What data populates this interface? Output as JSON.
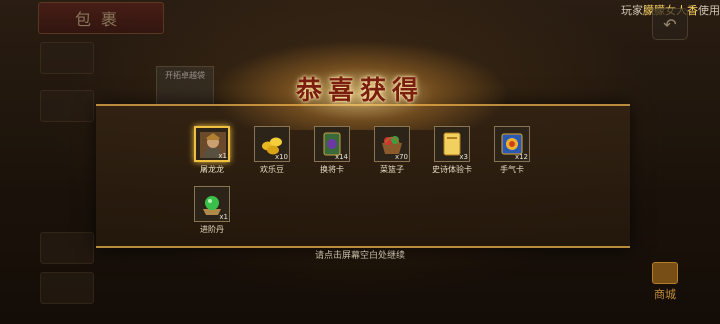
{
  "background": {
    "bag_tab": "包裹",
    "bag_card_label": "开拓卓越袋",
    "shop_label": "商城",
    "top_bar": {
      "prefix": "玩家",
      "player": "朦朦女人香",
      "suffix": "使用"
    }
  },
  "modal": {
    "title": "恭喜获得",
    "hint": "请点击屏幕空白处继续",
    "items": [
      {
        "name": "屠龙龙",
        "qty": "x1",
        "icon": "hero-portrait-icon",
        "selected": true
      },
      {
        "name": "欢乐豆",
        "qty": "x10",
        "icon": "gold-beans-icon"
      },
      {
        "name": "换将卡",
        "qty": "x14",
        "icon": "swap-card-icon"
      },
      {
        "name": "菜篮子",
        "qty": "x70",
        "icon": "vegetable-basket-icon"
      },
      {
        "name": "史诗体验卡",
        "qty": "x3",
        "icon": "epic-trial-card-icon"
      },
      {
        "name": "手气卡",
        "qty": "x12",
        "icon": "luck-card-icon"
      },
      {
        "name": "进阶丹",
        "qty": "x1",
        "icon": "advance-pill-icon"
      }
    ]
  }
}
